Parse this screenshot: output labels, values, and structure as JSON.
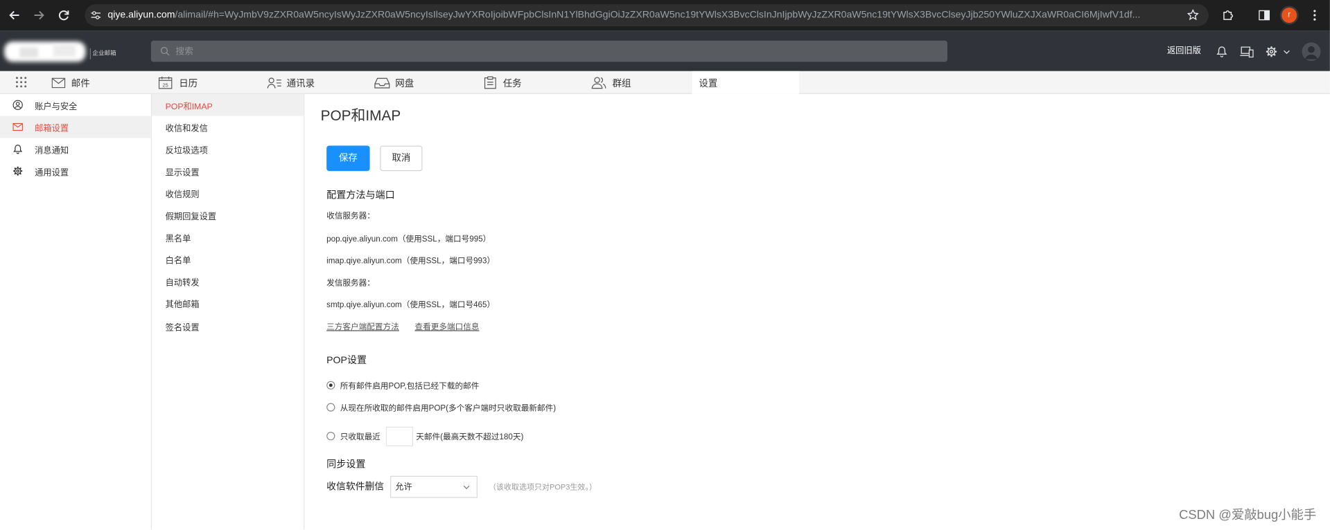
{
  "browser": {
    "url_host": "qiye.aliyun.com",
    "url_path": "/alimail/#h=WyJmbV9zZXR0aW5ncyIsWyJzZXR0aW5ncyIsIlseyJwYXRoIjoibWFpbClsInN1YlBhdGgiOiJzZXR0aW5nc19tYWlsX3BvcClsInJnIjpbWyJzZXR0aW5nc19tYWlsX3BvcClseyJjb250YWluZXJXaWR0aCI6MjIwfV1df...",
    "profile_initial": "r",
    "icons": [
      "back-icon",
      "forward-icon",
      "reload-icon",
      "site-info-icon",
      "star-icon",
      "extensions-icon",
      "side-panel-icon",
      "menu-icon"
    ]
  },
  "app_header": {
    "logo_caption": "企业邮箱",
    "search_placeholder": "搜索",
    "old_version_link": "返回旧版",
    "icons": [
      "search-icon",
      "bell-icon",
      "device-icon",
      "gear-icon",
      "chevron-down-icon",
      "avatar-icon"
    ]
  },
  "nav": {
    "calendar_day": "25",
    "tabs": [
      {
        "label": "邮件",
        "icon": "mail-icon"
      },
      {
        "label": "日历",
        "icon": "calendar-icon"
      },
      {
        "label": "通讯录",
        "icon": "contacts-icon"
      },
      {
        "label": "网盘",
        "icon": "drive-icon"
      },
      {
        "label": "任务",
        "icon": "task-icon"
      },
      {
        "label": "群组",
        "icon": "group-icon"
      },
      {
        "label": "设置",
        "icon": null,
        "active": true
      }
    ]
  },
  "settings_sidebar": {
    "items": [
      {
        "label": "账户与安全",
        "icon": "user-icon",
        "active": false
      },
      {
        "label": "邮箱设置",
        "icon": "mail-icon",
        "active": true
      },
      {
        "label": "消息通知",
        "icon": "bell-icon",
        "active": false
      },
      {
        "label": "通用设置",
        "icon": "gear-icon",
        "active": false
      }
    ]
  },
  "mailbox_menu": {
    "items": [
      {
        "label": "POP和IMAP",
        "active": true
      },
      {
        "label": "收信和发信",
        "active": false
      },
      {
        "label": "反垃圾选项",
        "active": false
      },
      {
        "label": "显示设置",
        "active": false
      },
      {
        "label": "收信规则",
        "active": false
      },
      {
        "label": "假期回复设置",
        "active": false
      },
      {
        "label": "黑名单",
        "active": false
      },
      {
        "label": "白名单",
        "active": false
      },
      {
        "label": "自动转发",
        "active": false
      },
      {
        "label": "其他邮箱",
        "active": false
      },
      {
        "label": "签名设置",
        "active": false
      }
    ]
  },
  "content": {
    "title": "POP和IMAP",
    "save_label": "保存",
    "cancel_label": "取消",
    "config": {
      "title": "配置方法与端口",
      "incoming_label": "收信服务器：",
      "incoming_servers": [
        "pop.qiye.aliyun.com（使用SSL，端口号995）",
        "imap.qiye.aliyun.com（使用SSL，端口号993）"
      ],
      "outgoing_label": "发信服务器：",
      "outgoing_servers": [
        "smtp.qiye.aliyun.com（使用SSL，端口号465）"
      ],
      "links": [
        "三方客户端配置方法",
        "查看更多端口信息"
      ]
    },
    "pop": {
      "title": "POP设置",
      "options": [
        {
          "label": "所有邮件启用POP,包括已经下载的邮件",
          "checked": true
        },
        {
          "label": "从现在所收取的邮件启用POP(多个客户端时只收取最新邮件)",
          "checked": false
        },
        {
          "prefix": "只收取最近",
          "days_value": "",
          "suffix": "天邮件(最高天数不超过180天)",
          "checked": false
        }
      ]
    },
    "sync": {
      "title": "同步设置",
      "delete_label": "收信软件删信",
      "delete_value": "允许",
      "hint": "（该收取选项只对POP3生效。）"
    }
  },
  "watermark": "CSDN @爱敲bug小能手",
  "theme": {
    "accent": "#1890ff",
    "active_red": "#e8473f",
    "topbar": "#1f1f1f",
    "header": "#30343a",
    "nav": "#f5f5f5"
  }
}
